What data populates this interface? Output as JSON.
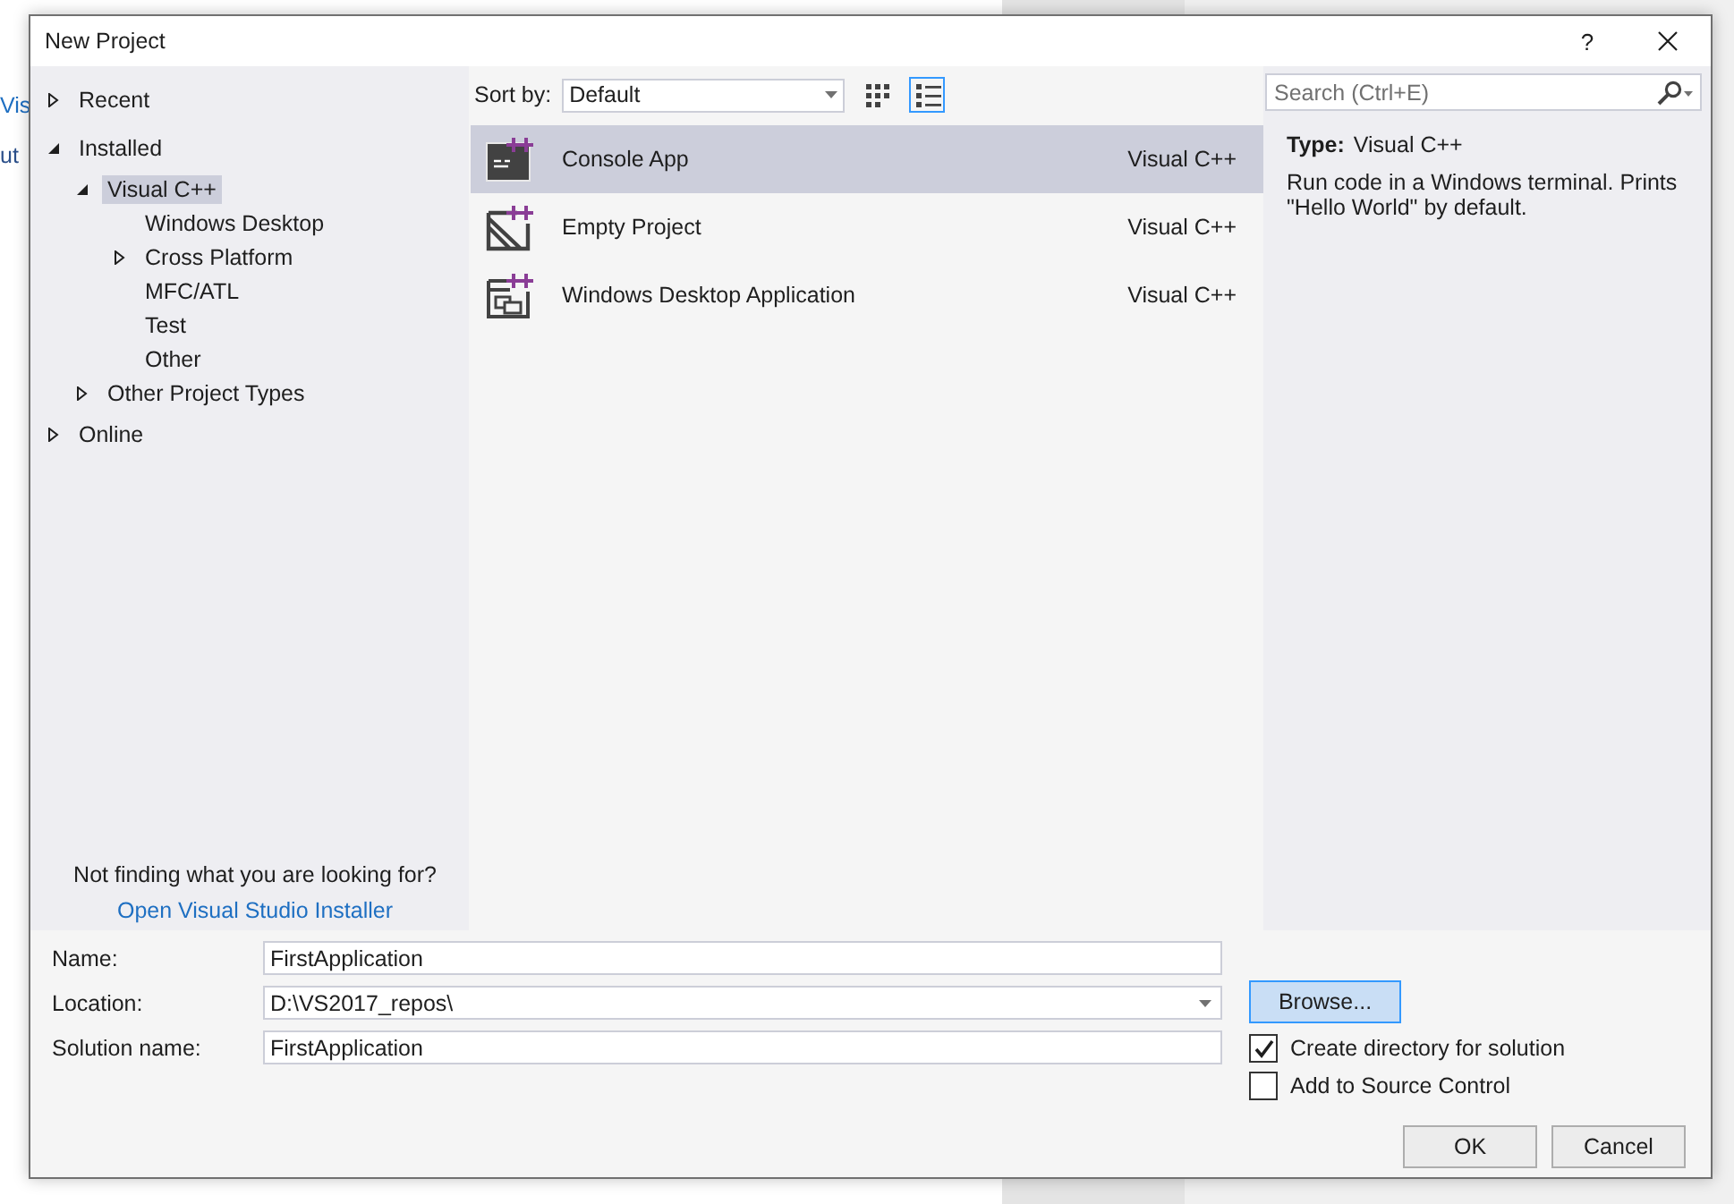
{
  "background": {
    "fragments": [
      "Vis",
      "ut"
    ]
  },
  "window": {
    "title": "New Project",
    "help": "?"
  },
  "tree": [
    {
      "label": "Recent",
      "expanded": false,
      "selected": false
    },
    {
      "label": "Installed",
      "expanded": true,
      "selected": false,
      "children": [
        {
          "label": "Visual C++",
          "expanded": true,
          "selected": true,
          "children": [
            {
              "label": "Windows Desktop",
              "selected": false
            },
            {
              "label": "Cross Platform",
              "expanded": false,
              "selected": false
            },
            {
              "label": "MFC/ATL",
              "selected": false
            },
            {
              "label": "Test",
              "selected": false
            },
            {
              "label": "Other",
              "selected": false
            }
          ]
        },
        {
          "label": "Other Project Types",
          "expanded": false,
          "selected": false
        }
      ]
    },
    {
      "label": "Online",
      "expanded": false,
      "selected": false
    }
  ],
  "hint": {
    "text": "Not finding what you are looking for?",
    "link": "Open Visual Studio Installer"
  },
  "toolbar": {
    "sort_label": "Sort by:",
    "sort_value": "Default",
    "views": [
      {
        "kind": "grid",
        "selected": false
      },
      {
        "kind": "list",
        "selected": true
      }
    ]
  },
  "templates": [
    {
      "name": "Console App",
      "language": "Visual C++",
      "kind": "console",
      "selected": true
    },
    {
      "name": "Empty Project",
      "language": "Visual C++",
      "kind": "empty",
      "selected": false
    },
    {
      "name": "Windows Desktop Application",
      "language": "Visual C++",
      "kind": "desktop",
      "selected": false
    }
  ],
  "search": {
    "placeholder": "Search (Ctrl+E)"
  },
  "details": {
    "type_label": "Type:",
    "type_value": "Visual C++",
    "description": "Run code in a Windows terminal. Prints \"Hello World\" by default."
  },
  "fields": [
    {
      "label": "Name:",
      "value": "FirstApplication",
      "kind": "text"
    },
    {
      "label": "Location:",
      "value": "D:\\VS2017_repos\\",
      "kind": "dropdown"
    },
    {
      "label": "Solution name:",
      "value": "FirstApplication",
      "kind": "text"
    }
  ],
  "browse_button": "Browse...",
  "options": [
    {
      "label": "Create directory for solution",
      "checked": true
    },
    {
      "label": "Add to Source Control",
      "checked": false
    }
  ],
  "buttons": [
    "OK",
    "Cancel"
  ]
}
